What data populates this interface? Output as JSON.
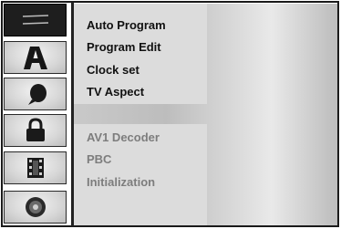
{
  "sidebar": {
    "tabs": [
      {
        "icon": "menu-lines-icon",
        "active": true
      },
      {
        "icon": "letter-a-icon",
        "active": false
      },
      {
        "icon": "speech-bubble-icon",
        "active": false
      },
      {
        "icon": "padlock-icon",
        "active": false
      },
      {
        "icon": "film-strip-icon",
        "active": false
      },
      {
        "icon": "disc-icon",
        "active": false
      }
    ]
  },
  "menu": {
    "items": [
      {
        "label": "Auto Program",
        "enabled": true
      },
      {
        "label": "Program Edit",
        "enabled": true
      },
      {
        "label": "Clock set",
        "enabled": true
      },
      {
        "label": "TV Aspect",
        "enabled": true
      },
      {
        "label": "AV1 Decoder",
        "enabled": false
      },
      {
        "label": "PBC",
        "enabled": false
      },
      {
        "label": "Initialization",
        "enabled": false
      }
    ]
  },
  "colors": {
    "active_tab": "#1e1e1e",
    "enabled_text": "#111111",
    "disabled_text": "#7d7d7d"
  }
}
